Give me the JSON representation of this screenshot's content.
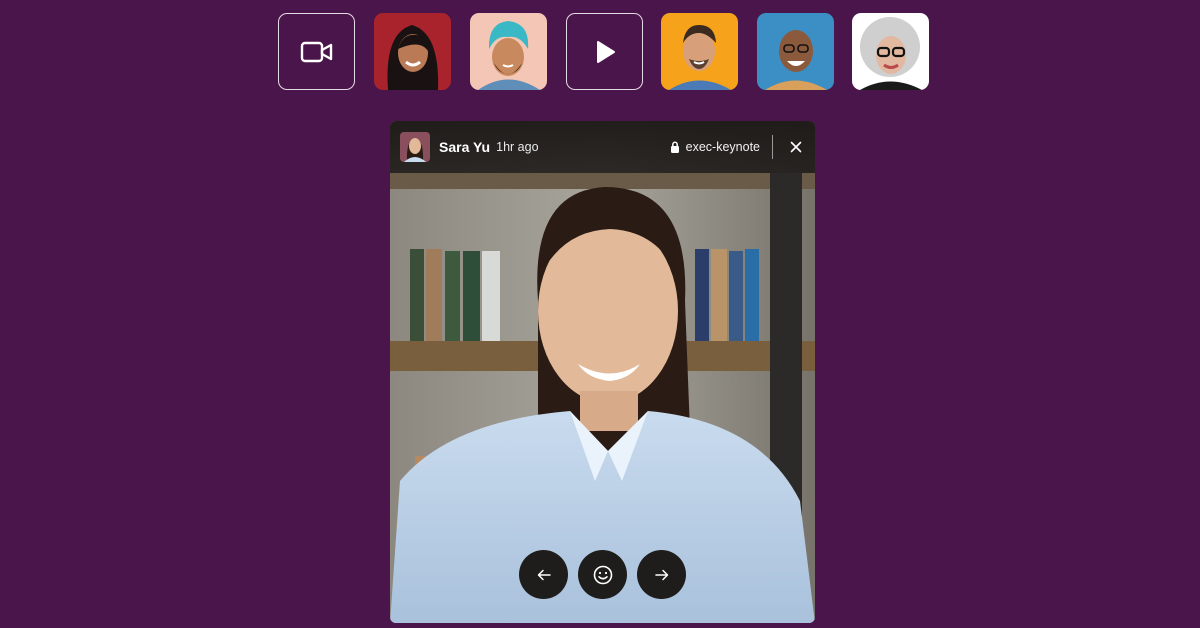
{
  "top_row": {
    "items": [
      {
        "kind": "button",
        "icon": "video-camera-icon"
      },
      {
        "kind": "avatar",
        "bg": "#a8232b",
        "skin": "#b97a55",
        "hair": "#1a1212"
      },
      {
        "kind": "avatar",
        "bg": "#f3c6b5",
        "skin": "#c9895e",
        "hair": "#2a1a12",
        "turban": "#3ab8c6"
      },
      {
        "kind": "button",
        "icon": "play-icon"
      },
      {
        "kind": "avatar",
        "bg": "#f7a21b",
        "skin": "#d8a07a",
        "hair": "#3b2a20"
      },
      {
        "kind": "avatar",
        "bg": "#3b8fc4",
        "skin": "#8b5a3c",
        "hair": "#2a1a12"
      },
      {
        "kind": "avatar",
        "bg": "#ffffff",
        "skin": "#e2b8a0",
        "hair": "#cfcfcf"
      }
    ]
  },
  "card": {
    "author": "Sara Yu",
    "time": "1hr ago",
    "channel": "exec-keynote",
    "controls": [
      "arrow-left-icon",
      "smiley-icon",
      "arrow-right-icon"
    ]
  },
  "colors": {
    "background": "#4a154b",
    "header": "#1c1816",
    "control": "#1f1d1c"
  }
}
